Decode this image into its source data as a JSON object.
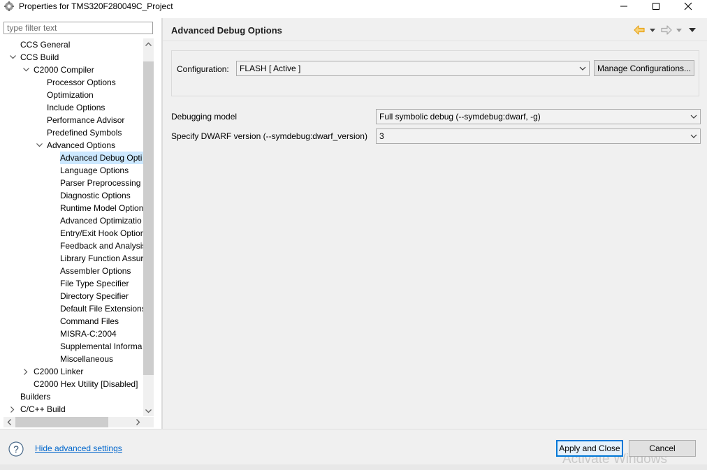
{
  "window": {
    "title": "Properties for TMS320F280049C_Project",
    "icons": [
      "app-gear-icon",
      "minimize-icon",
      "maximize-icon",
      "close-icon"
    ]
  },
  "sidebar": {
    "filter_placeholder": "type filter text",
    "tree": [
      {
        "label": "CCS General",
        "expander": "none"
      },
      {
        "label": "CCS Build",
        "expander": "expanded"
      },
      {
        "label": "C2000 Compiler",
        "expander": "expanded"
      },
      {
        "label": "Processor Options",
        "expander": "none"
      },
      {
        "label": "Optimization",
        "expander": "none"
      },
      {
        "label": "Include Options",
        "expander": "none"
      },
      {
        "label": "Performance Advisor",
        "expander": "none"
      },
      {
        "label": "Predefined Symbols",
        "expander": "none"
      },
      {
        "label": "Advanced Options",
        "expander": "expanded"
      },
      {
        "label": "Advanced Debug Opti",
        "expander": "none",
        "selected": true
      },
      {
        "label": "Language Options",
        "expander": "none"
      },
      {
        "label": "Parser Preprocessing C",
        "expander": "none"
      },
      {
        "label": "Diagnostic Options",
        "expander": "none"
      },
      {
        "label": "Runtime Model Option",
        "expander": "none"
      },
      {
        "label": "Advanced Optimizatio",
        "expander": "none"
      },
      {
        "label": "Entry/Exit Hook Option",
        "expander": "none"
      },
      {
        "label": "Feedback and Analysis",
        "expander": "none"
      },
      {
        "label": "Library Function Assur",
        "expander": "none"
      },
      {
        "label": "Assembler Options",
        "expander": "none"
      },
      {
        "label": "File Type Specifier",
        "expander": "none"
      },
      {
        "label": "Directory Specifier",
        "expander": "none"
      },
      {
        "label": "Default File Extensions",
        "expander": "none"
      },
      {
        "label": "Command Files",
        "expander": "none"
      },
      {
        "label": "MISRA-C:2004",
        "expander": "none"
      },
      {
        "label": "Supplemental Informa",
        "expander": "none"
      },
      {
        "label": "Miscellaneous",
        "expander": "none"
      },
      {
        "label": "C2000 Linker",
        "expander": "collapsed"
      },
      {
        "label": "C2000 Hex Utility  [Disabled]",
        "expander": "none"
      },
      {
        "label": "Builders",
        "expander": "none"
      },
      {
        "label": "C/C++ Build",
        "expander": "collapsed"
      }
    ]
  },
  "main": {
    "title": "Advanced Debug Options",
    "nav_icons": [
      "back-arrow-icon",
      "back-menu-icon",
      "forward-arrow-icon",
      "forward-menu-icon",
      "view-menu-icon"
    ],
    "configuration": {
      "label": "Configuration:",
      "value": "FLASH  [ Active ]",
      "manage_button": "Manage Configurations..."
    },
    "options": [
      {
        "label": "Debugging model",
        "value": "Full symbolic debug (--symdebug:dwarf, -g)"
      },
      {
        "label": "Specify DWARF version (--symdebug:dwarf_version)",
        "value": "3"
      }
    ]
  },
  "footer": {
    "help_icon": "help-icon",
    "hide_advanced_link": "Hide advanced settings",
    "apply_button": "Apply and Close",
    "cancel_button": "Cancel",
    "watermark": "Activate Windows"
  },
  "colors": {
    "selection": "#cce8ff",
    "link": "#0066cc",
    "nav_arrow": "#e8a317",
    "default_button_border": "#0078d7"
  }
}
